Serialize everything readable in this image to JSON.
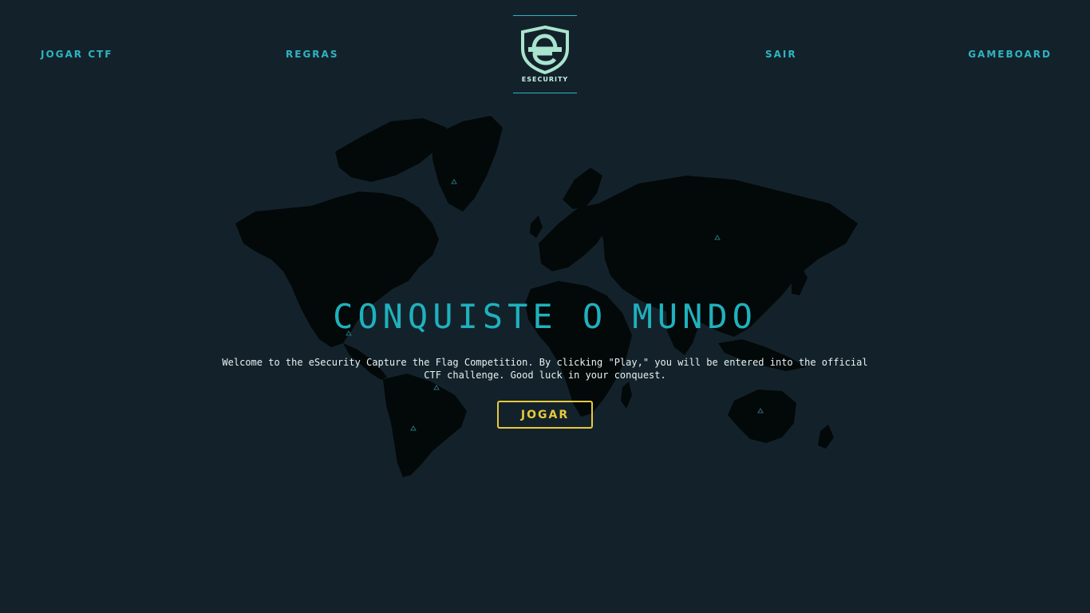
{
  "nav": {
    "play_ctf": "JOGAR CTF",
    "rules": "REGRAS",
    "exit": "SAIR",
    "gameboard": "GAMEBOARD"
  },
  "logo": {
    "brand_text": "ESECURITY"
  },
  "hero": {
    "title": "CONQUISTE O MUNDO",
    "intro": "Welcome to the eSecurity Capture the Flag Competition. By clicking \"Play,\" you will be entered into the official CTF challenge. Good luck in your conquest.",
    "play_button": "JOGAR"
  },
  "colors": {
    "background": "#13222a",
    "accent": "#2fb3c2",
    "button": "#e8c93d",
    "map_land": "#030809"
  }
}
